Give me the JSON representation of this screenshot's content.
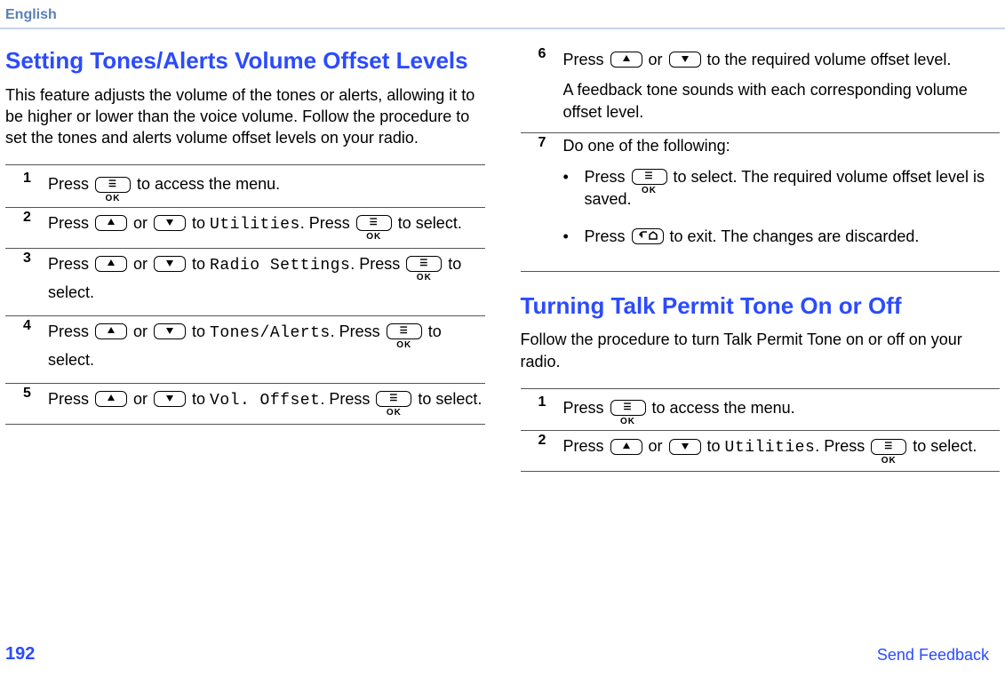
{
  "header": {
    "language": "English"
  },
  "section1": {
    "title": "Setting Tones/Alerts Volume Offset Levels",
    "intro": "This feature adjusts the volume of the tones or alerts, allowing it to be higher or lower than the voice volume. Follow the procedure to set the tones and alerts volume offset levels on your radio.",
    "steps": {
      "s1": {
        "num": "1",
        "a": "Press ",
        "b": " to access the menu."
      },
      "s2": {
        "num": "2",
        "a": "Press ",
        "b": " or ",
        "c": " to ",
        "lcd": "Utilities",
        "d": ". Press ",
        "e": " to select."
      },
      "s3": {
        "num": "3",
        "a": "Press ",
        "b": " or ",
        "c": " to ",
        "lcd": "Radio Settings",
        "d": ". Press ",
        "e": " to select."
      },
      "s4": {
        "num": "4",
        "a": "Press ",
        "b": " or ",
        "c": " to ",
        "lcd": "Tones/Alerts",
        "d": ". Press ",
        "e": " to select."
      },
      "s5": {
        "num": "5",
        "a": "Press ",
        "b": " or ",
        "c": " to ",
        "lcd": "Vol. Offset",
        "d": ". Press ",
        "e": " to select."
      },
      "s6": {
        "num": "6",
        "a": "Press ",
        "b": " or ",
        "c": " to the required volume offset level.",
        "note": "A feedback tone sounds with each corresponding volume offset level."
      },
      "s7": {
        "num": "7",
        "lead": "Do one of the following:",
        "b1a": "Press ",
        "b1b": " to select. The required volume offset level is saved.",
        "b2a": "Press ",
        "b2b": " to exit. The changes are discarded."
      }
    }
  },
  "section2": {
    "title": "Turning Talk Permit Tone On or Off",
    "intro": "Follow the procedure to turn Talk Permit Tone on or off on your radio.",
    "steps": {
      "s1": {
        "num": "1",
        "a": "Press ",
        "b": " to access the menu."
      },
      "s2": {
        "num": "2",
        "a": "Press ",
        "b": " or ",
        "c": " to ",
        "lcd": "Utilities",
        "d": ". Press ",
        "e": " to select."
      }
    }
  },
  "footer": {
    "page": "192",
    "feedback": "Send Feedback"
  }
}
